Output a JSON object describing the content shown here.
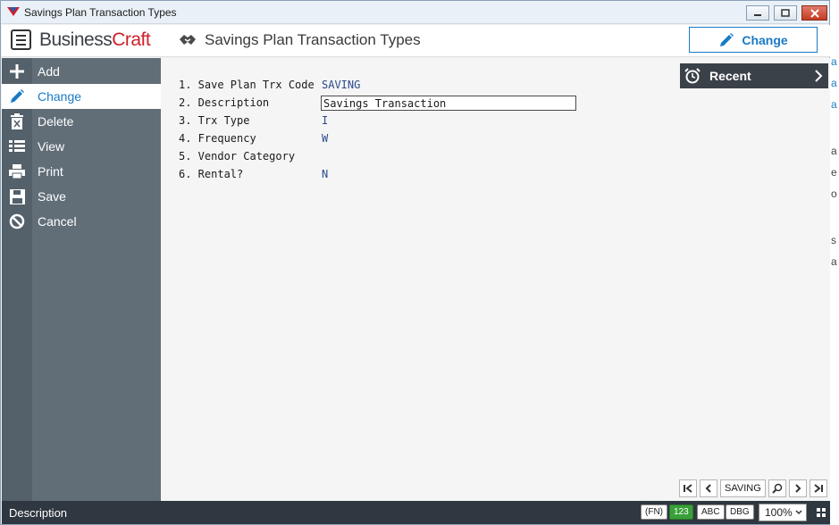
{
  "window": {
    "title": "Savings Plan Transaction Types"
  },
  "header": {
    "logo_part1": "Business",
    "logo_part2": "Craft",
    "page_title": "Savings Plan Transaction Types",
    "action_label": "Change"
  },
  "sidebar": {
    "items": [
      {
        "label": "Add",
        "icon": "plus-icon"
      },
      {
        "label": "Change",
        "icon": "pencil-icon",
        "active": true
      },
      {
        "label": "Delete",
        "icon": "trash-icon"
      },
      {
        "label": "View",
        "icon": "list-icon"
      },
      {
        "label": "Print",
        "icon": "printer-icon"
      },
      {
        "label": "Save",
        "icon": "floppy-icon"
      },
      {
        "label": "Cancel",
        "icon": "cancel-icon"
      }
    ]
  },
  "form": {
    "fields": [
      {
        "label": "1. Save Plan Trx Code",
        "value": "SAVING"
      },
      {
        "label": "2. Description",
        "value": "Savings Transaction",
        "editable": true
      },
      {
        "label": "3. Trx Type",
        "value": "I"
      },
      {
        "label": "4. Frequency",
        "value": "W"
      },
      {
        "label": "5. Vendor Category",
        "value": ""
      },
      {
        "label": "6. Rental?",
        "value": "N"
      }
    ]
  },
  "recent": {
    "label": "Recent"
  },
  "navigator": {
    "current_code": "SAVING"
  },
  "statusbar": {
    "text": "Description",
    "badges": {
      "fn": "(FN)",
      "num": "123",
      "abc": "ABC",
      "dbg": "DBG"
    },
    "zoom": "100%"
  },
  "background_window": {
    "fragments": [
      "a",
      "a",
      "a",
      "a",
      "e",
      "o",
      "s",
      "a"
    ]
  },
  "colors": {
    "accent": "#1a7ac4",
    "sidebar": "#616e78",
    "statusbar": "#2f3740",
    "logo_red": "#d0202a",
    "num_badge": "#3aa03a"
  }
}
